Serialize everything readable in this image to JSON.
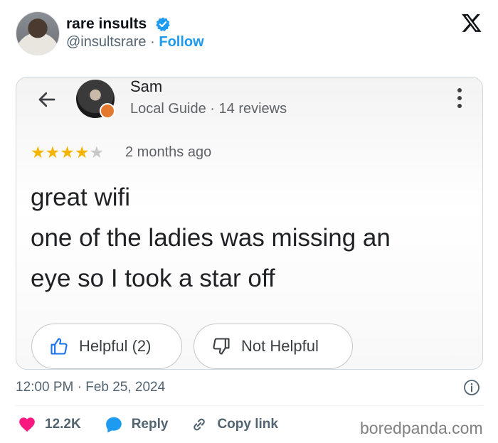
{
  "tweet": {
    "author": {
      "display_name": "rare insults",
      "handle": "@insultsrare",
      "separator": "·",
      "follow_label": "Follow",
      "verified": true,
      "avatar_icon": "user-avatar"
    },
    "platform_icon": "x-logo-icon",
    "timestamp": "12:00 PM · Feb 25, 2024",
    "info_icon": "info-icon",
    "actions": {
      "like_count": "12.2K",
      "reply_label": "Reply",
      "copy_label": "Copy link"
    },
    "colors": {
      "accent": "#1d9bf0",
      "like": "#f91880",
      "text_secondary": "#536471"
    }
  },
  "review_card": {
    "reviewer_name": "Sam",
    "reviewer_meta": "Local Guide · 14 reviews",
    "rating": 4,
    "rating_max": 5,
    "time_ago": "2 months ago",
    "lines": [
      "great wifi",
      "one of the ladies was missing an",
      "eye so I took a star off"
    ],
    "helpful_label": "Helpful (2)",
    "not_helpful_label": "Not Helpful",
    "colors": {
      "star_on": "#f4b400",
      "star_off": "#c8c8c8"
    }
  },
  "watermark": "boredpanda.com"
}
